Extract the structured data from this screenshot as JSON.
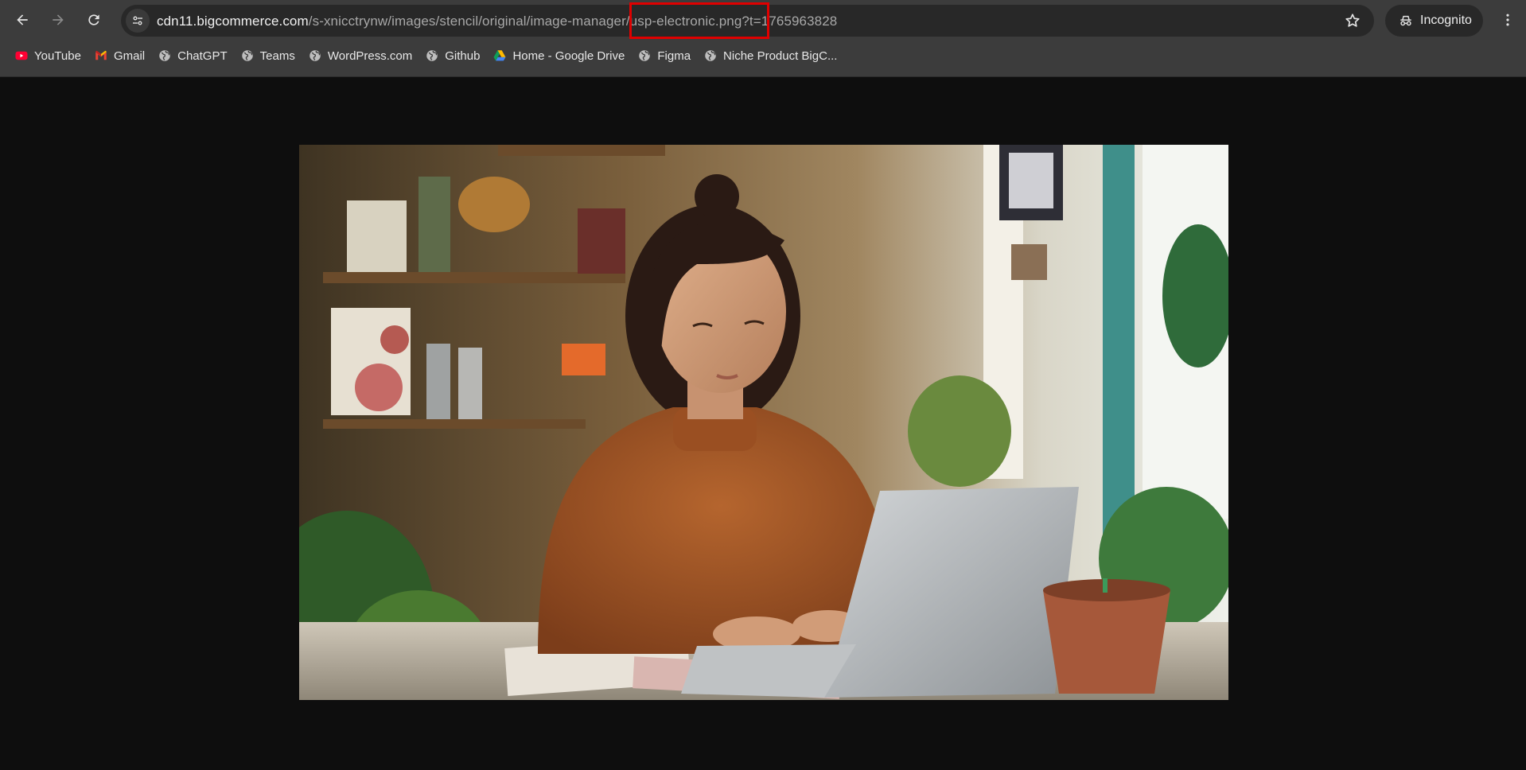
{
  "browser": {
    "url_host": "cdn11.bigcommerce.com",
    "url_path": "/s-xnicctrynw/images/stencil/original/image-manager/usp-electronic.png?t=1765963828",
    "incognito_label": "Incognito"
  },
  "bookmarks": [
    {
      "label": "YouTube",
      "icon": "youtube-icon"
    },
    {
      "label": "Gmail",
      "icon": "gmail-icon"
    },
    {
      "label": "ChatGPT",
      "icon": "globe-icon"
    },
    {
      "label": "Teams",
      "icon": "globe-icon"
    },
    {
      "label": "WordPress.com",
      "icon": "globe-icon"
    },
    {
      "label": "Github",
      "icon": "globe-icon"
    },
    {
      "label": "Home - Google Drive",
      "icon": "google-drive-icon"
    },
    {
      "label": "Figma",
      "icon": "globe-icon"
    },
    {
      "label": "Niche Product BigC...",
      "icon": "globe-icon"
    }
  ],
  "colors": {
    "highlight": "#e00000",
    "page_background": "#0e0e0e",
    "toolbar": "#3c3c3c"
  }
}
